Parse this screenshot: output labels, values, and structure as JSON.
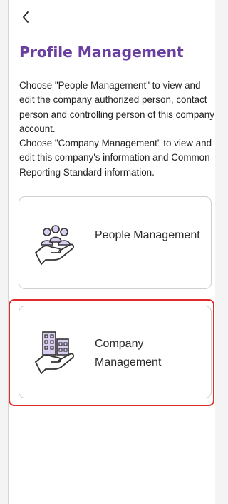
{
  "header": {
    "back_icon": "chevron-left-icon",
    "title": "Profile Management"
  },
  "description": {
    "line1": "Choose \"People Management\" to view and edit the company authorized person, contact person and controlling person of this company account.",
    "line2": "Choose \"Company Management\" to view and edit this company's information and Common Reporting Standard information."
  },
  "options": [
    {
      "label": "People Management",
      "icon": "people-in-hand-icon"
    },
    {
      "label": "Company Management",
      "icon": "buildings-in-hand-icon"
    }
  ],
  "colors": {
    "title": "#6b3fa0",
    "icon_fill": "#d9cdf0",
    "highlight_border": "#e02b2b"
  }
}
